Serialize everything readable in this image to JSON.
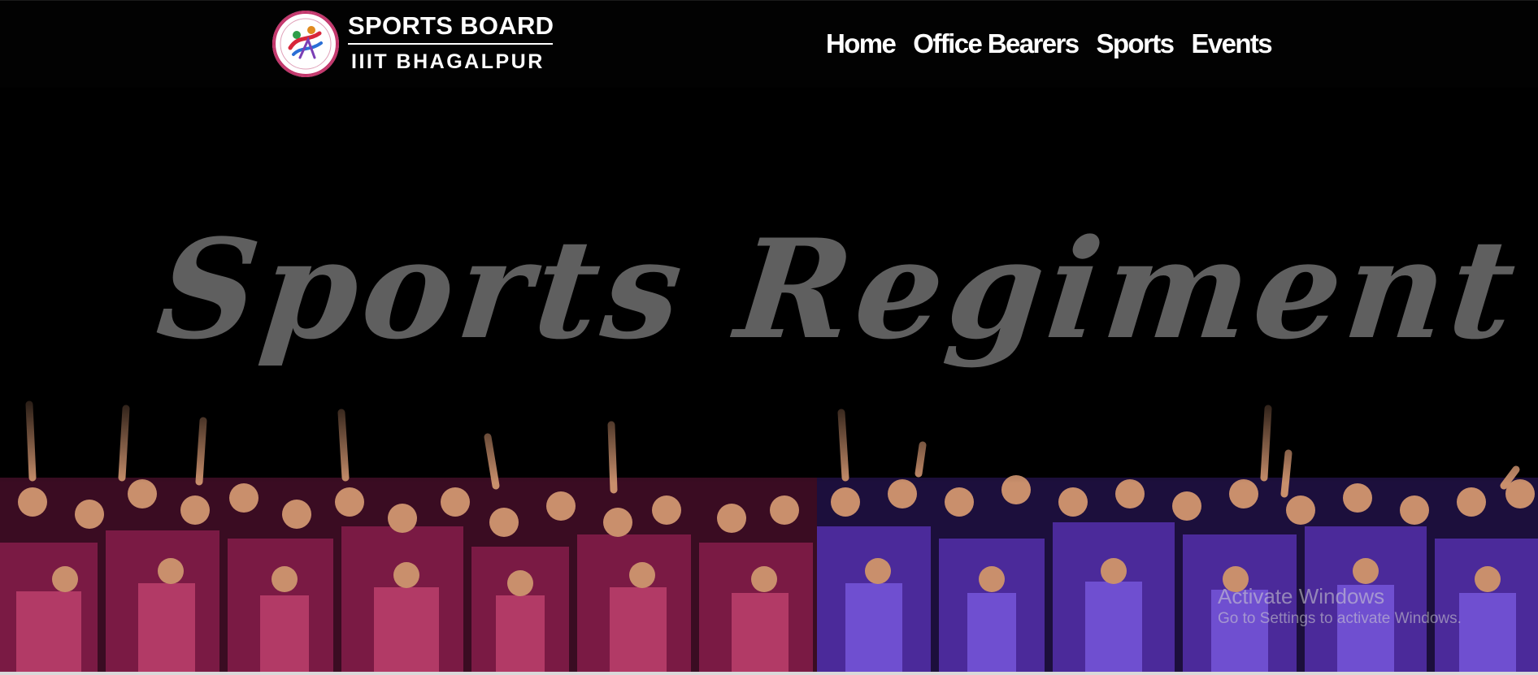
{
  "header": {
    "brand_title": "SPORTS BOARD",
    "brand_subtitle": "IIIT BHAGALPUR",
    "logo_icon": "sports-board-emblem",
    "logo_text": "SPORTS BOARD"
  },
  "nav": {
    "items": [
      {
        "label": "Home"
      },
      {
        "label": "Office Bearers"
      },
      {
        "label": "Sports"
      },
      {
        "label": "Events"
      }
    ]
  },
  "hero": {
    "title": "Sports Regiment",
    "left_team_color": "#8a1f4a",
    "right_team_color": "#4b2a9a"
  },
  "os_watermark": {
    "title": "Activate Windows",
    "subtitle": "Go to Settings to activate Windows."
  }
}
